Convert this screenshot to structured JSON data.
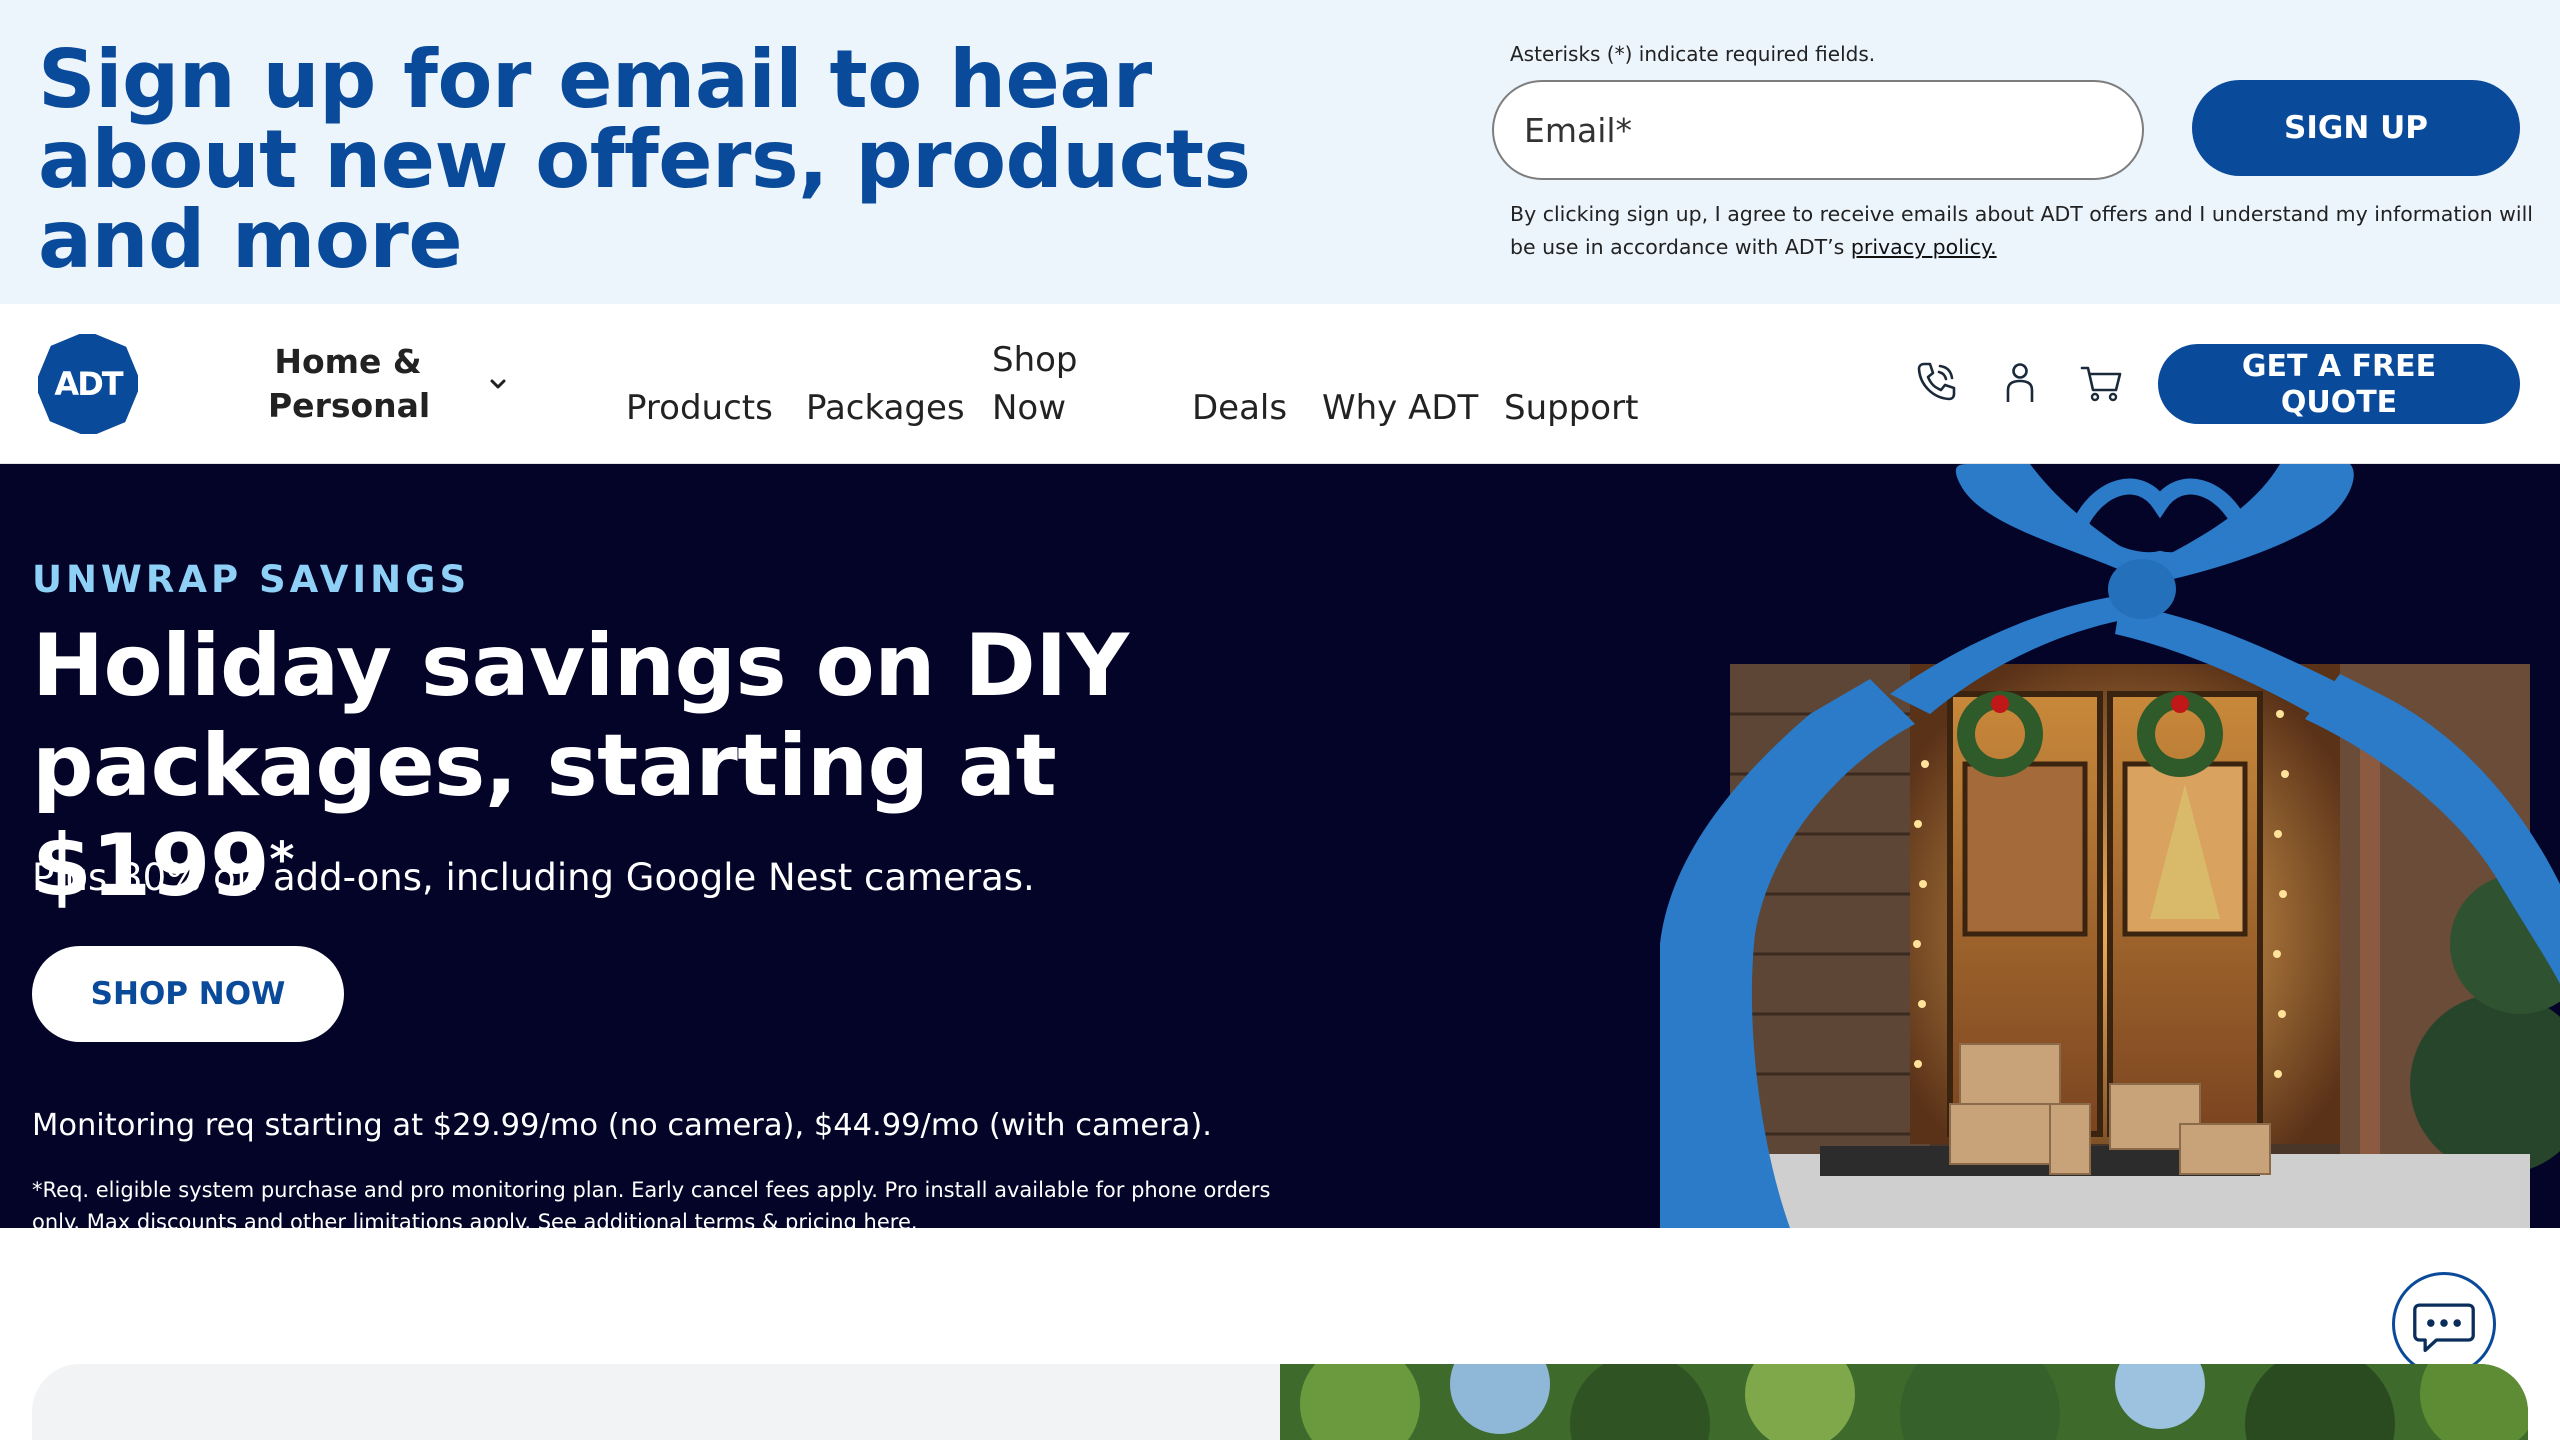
{
  "signup": {
    "heading": "Sign up for email to hear about new offers, products and more",
    "required_note": "Asterisks (*) indicate required fields.",
    "email_placeholder": "Email*",
    "button_label": "SIGN UP",
    "consent_text": "By clicking sign up, I agree to receive emails about ADT offers and I understand my information will be use in accordance with ADT’s",
    "privacy_link": "privacy policy."
  },
  "nav": {
    "logo_text": "ADT",
    "home_personal": "Home & Personal",
    "links": [
      "Products",
      "Packages",
      "Shop Now",
      "Deals",
      "Why ADT",
      "Support"
    ],
    "quote_button": "GET A FREE QUOTE"
  },
  "hero": {
    "eyebrow": "UNWRAP SAVINGS",
    "title": "Holiday savings on DIY packages, starting at $199",
    "title_mark": "*",
    "subtitle": "Plus 30% off add-ons, including Google Nest cameras.",
    "shop_button": "SHOP NOW",
    "monitoring": "Monitoring req starting at $29.99/mo (no camera), $44.99/mo (with camera).",
    "fine_print": "*Req. eligible system purchase and pro monitoring plan. Early cancel fees apply. Pro install available for phone orders only. Max discounts and other limitations apply. See additional terms & pricing here."
  },
  "colors": {
    "brand_blue": "#0a4a9a",
    "signup_bg": "#ecf4fc",
    "hero_bg": "#040428",
    "eyebrow": "#8fd0f7",
    "ribbon": "#2b7bc9"
  },
  "icons": [
    "phone-icon",
    "account-icon",
    "cart-icon",
    "chevron-down-icon",
    "chat-icon"
  ]
}
